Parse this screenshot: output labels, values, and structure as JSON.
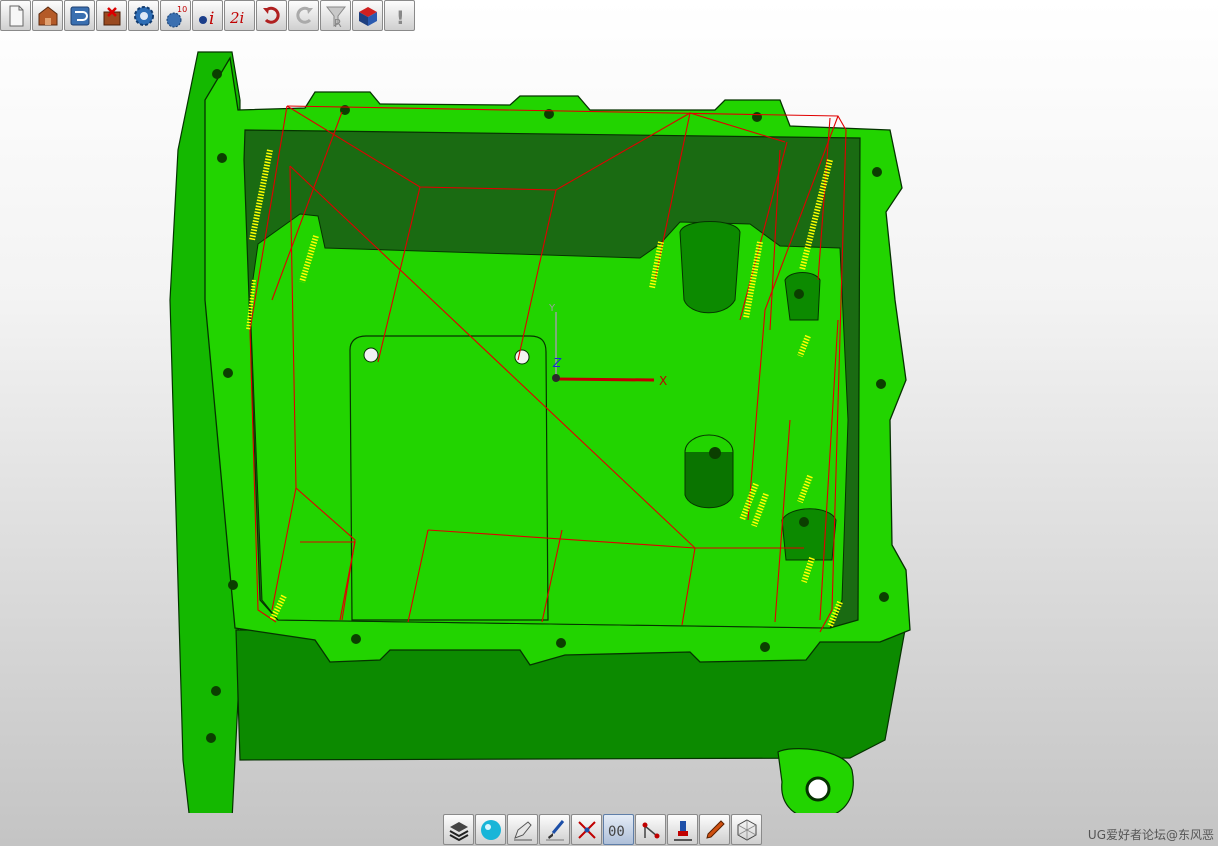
{
  "top_toolbar": [
    {
      "id": "new",
      "icon": "new-file-icon"
    },
    {
      "id": "open",
      "icon": "open-part-icon"
    },
    {
      "id": "save",
      "icon": "save-icon"
    },
    {
      "id": "setup",
      "icon": "setup-icon"
    },
    {
      "id": "settings",
      "icon": "gear-settings-icon"
    },
    {
      "id": "generate",
      "icon": "generate-toolpath-icon",
      "text": "10"
    },
    {
      "id": "info",
      "icon": "info-icon",
      "text": "i"
    },
    {
      "id": "info2",
      "icon": "info-2-icon",
      "text": "2i"
    },
    {
      "id": "undo",
      "icon": "undo-icon"
    },
    {
      "id": "redo",
      "icon": "redo-icon"
    },
    {
      "id": "filter",
      "icon": "filter-icon",
      "text": "R"
    },
    {
      "id": "material",
      "icon": "material-block-icon"
    },
    {
      "id": "alert",
      "icon": "alert-icon",
      "text": "!"
    }
  ],
  "bottom_toolbar": [
    {
      "id": "layers",
      "icon": "layers-icon"
    },
    {
      "id": "render",
      "icon": "render-sphere-icon"
    },
    {
      "id": "pen",
      "icon": "pen-icon"
    },
    {
      "id": "brush",
      "icon": "brush-icon"
    },
    {
      "id": "pick",
      "icon": "pick-point-icon"
    },
    {
      "id": "counter",
      "icon": "counter-icon",
      "text": "00"
    },
    {
      "id": "node",
      "icon": "node-icon"
    },
    {
      "id": "tool",
      "icon": "tool-holder-icon"
    },
    {
      "id": "pencil",
      "icon": "pencil-icon"
    },
    {
      "id": "wireframe",
      "icon": "wireframe-icon"
    }
  ],
  "viewport": {
    "axis_x_label": "X",
    "axis_y_label": "Y",
    "axis_z_label": "Z",
    "part_color": "#22d400",
    "toolpath_color": "#e00000",
    "thread_color": "#ffff00"
  },
  "watermark": "UG爱好者论坛@东风恶"
}
